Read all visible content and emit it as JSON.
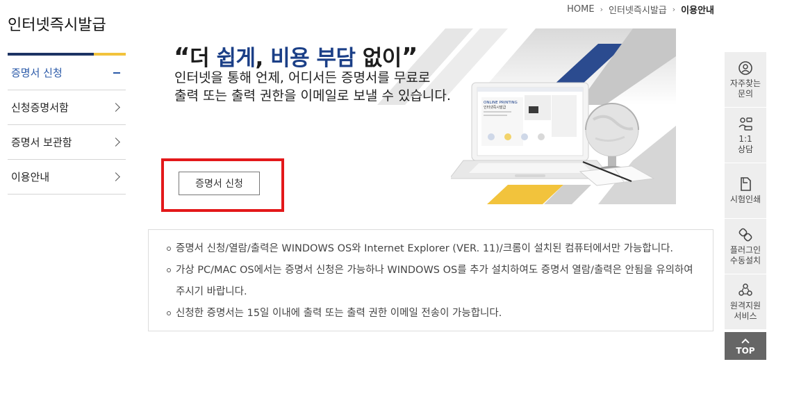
{
  "breadcrumb": {
    "home": "HOME",
    "level1": "인터넷즉시발급",
    "current": "이용안내",
    "separator": "›"
  },
  "sidebar": {
    "title": "인터넷즉시발급",
    "items": [
      {
        "label": "증명서 신청",
        "state": "active",
        "icon": "minus-icon"
      },
      {
        "label": "신청증명서함",
        "state": "collapsed",
        "icon": "chevron-right-icon"
      },
      {
        "label": "증명서 보관함",
        "state": "collapsed",
        "icon": "chevron-right-icon"
      },
      {
        "label": "이용안내",
        "state": "collapsed",
        "icon": "chevron-right-icon"
      }
    ]
  },
  "banner": {
    "quote_open": "“",
    "headline_1": "더 ",
    "headline_accent_1": "쉽게",
    "headline_2": ", ",
    "headline_accent_2": "비용 부담",
    "headline_3": " 없이",
    "quote_close": "”",
    "subtext_line1": "인터넷을 통해 언제, 어디서든 증명서를 무료로",
    "subtext_line2": "출력 또는 출력 권한을 이메일로 보낼 수 있습니다.",
    "button_label": "증명서 신청",
    "screen_title": "ONLINE PRINTING",
    "screen_subtitle": "인터넷즉시발급"
  },
  "notice": {
    "items": [
      "증명서 신청/열람/출력은 WINDOWS OS와 Internet Explorer (VER. 11)/크롬이 설치된 컴퓨터에서만 가능합니다.",
      "가상 PC/MAC OS에서는 증명서 신청은 가능하나 WINDOWS OS를 추가 설치하여도 증명서 열람/출력은 안됨을 유의하여 주시기 바랍니다.",
      "신청한 증명서는 15일 이내에 출력 또는 출력 권한 이메일 전송이 가능합니다."
    ]
  },
  "quick_menu": {
    "items": [
      {
        "label": "자주찾는\n문의",
        "icon": "faq-icon"
      },
      {
        "label": "1:1\n상담",
        "icon": "consult-icon"
      },
      {
        "label": "시험인쇄",
        "icon": "print-test-icon"
      },
      {
        "label": "플러그인\n수동설치",
        "icon": "plugin-icon"
      },
      {
        "label": "원격지원\n서비스",
        "icon": "remote-support-icon"
      }
    ],
    "top_label": "TOP"
  },
  "colors": {
    "navy": "#1b3f87",
    "yellow": "#f2c33c",
    "active_blue": "#2a59a8",
    "highlight_red": "#e3181a"
  }
}
